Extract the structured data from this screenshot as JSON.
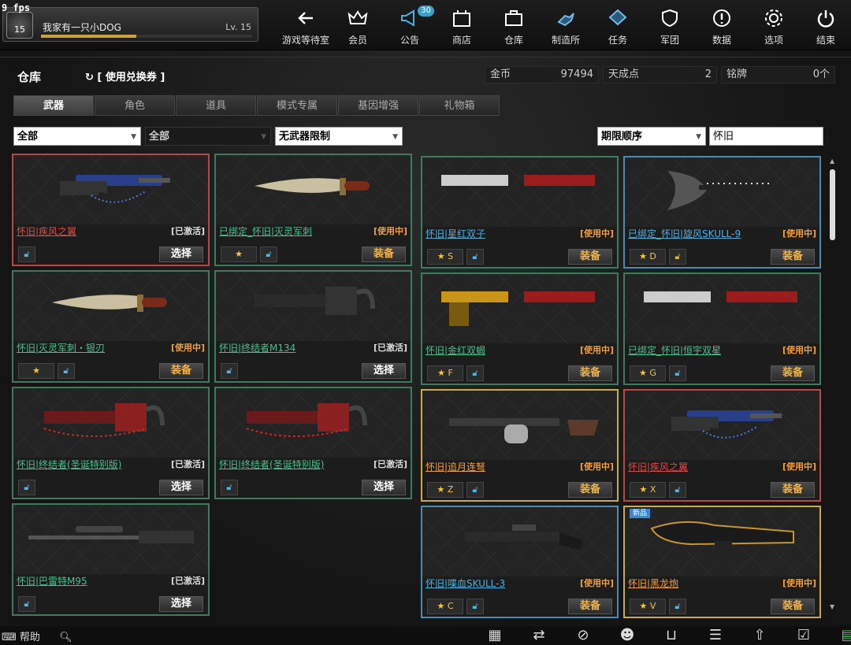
{
  "fps": "9 fps",
  "player": {
    "rank": "15",
    "name": "我家有一只小DOG",
    "level": "Lv. 15"
  },
  "nav": [
    {
      "label": "游戏等待室",
      "icon": "arrow-left-icon"
    },
    {
      "label": "会员",
      "icon": "crown-icon"
    },
    {
      "label": "公告",
      "icon": "megaphone-icon",
      "badge": "30"
    },
    {
      "label": "商店",
      "icon": "shop-icon"
    },
    {
      "label": "仓库",
      "icon": "briefcase-icon"
    },
    {
      "label": "制造所",
      "icon": "craft-icon"
    },
    {
      "label": "任务",
      "icon": "ticket-icon"
    },
    {
      "label": "军团",
      "icon": "shield-icon"
    },
    {
      "label": "数据",
      "icon": "info-icon"
    },
    {
      "label": "选项",
      "icon": "gear-icon"
    },
    {
      "label": "结束",
      "icon": "power-icon"
    }
  ],
  "header": {
    "title": "仓库",
    "coupon": "[ 使用兑换券 ]"
  },
  "currency": [
    {
      "label": "金币",
      "value": "97494"
    },
    {
      "label": "天成点",
      "value": "2"
    },
    {
      "label": "铭牌",
      "value": "0个"
    }
  ],
  "tabs": [
    "武器",
    "角色",
    "道具",
    "模式专属",
    "基因增强",
    "礼物箱"
  ],
  "filters": {
    "f1": "全部",
    "f2": "全部",
    "f3": "无武器限制",
    "sort": "期限顺序",
    "search": "怀旧"
  },
  "left_items": [
    {
      "name": "怀旧|疾风之翼",
      "status": "[已激活]",
      "button": "选择",
      "star": "",
      "color": "#e04848",
      "border": "#b84848",
      "w": "rifle-blue"
    },
    {
      "name": "已绑定_怀旧|灭灵军刺",
      "status": "[使用中]",
      "button": "装备",
      "star": "★",
      "color": "#47c08e",
      "border": "#3f7a5d",
      "w": "knife"
    },
    {
      "name": "怀旧|灭灵军刺・银刃",
      "status": "[使用中]",
      "button": "装备",
      "star": "★",
      "color": "#47c08e",
      "border": "#3f7a5d",
      "w": "knife"
    },
    {
      "name": "怀旧|终结者M134",
      "status": "[已激活]",
      "button": "选择",
      "star": "",
      "color": "#47c08e",
      "border": "#3f7a5d",
      "w": "minigun"
    },
    {
      "name": "怀旧|终结者(圣诞特别版)",
      "status": "[已激活]",
      "button": "选择",
      "star": "",
      "color": "#47c08e",
      "border": "#3f7a5d",
      "w": "minigun-red"
    },
    {
      "name": "怀旧|终结者(圣诞特别版)",
      "status": "[已激活]",
      "button": "选择",
      "star": "",
      "color": "#47c08e",
      "border": "#3f7a5d",
      "w": "minigun-red"
    },
    {
      "name": "怀旧|巴雷特M95",
      "status": "[已激活]",
      "button": "选择",
      "star": "",
      "color": "#47c08e",
      "border": "#3f7a5d",
      "w": "sniper"
    }
  ],
  "right_items": [
    {
      "name": "怀旧|星红双子",
      "status": "[使用中]",
      "button": "装备",
      "star": "★ S",
      "color": "#4ab0e0",
      "border": "#3f7a5d",
      "w": "pistols"
    },
    {
      "name": "已绑定_怀旧|旋风SKULL-9",
      "status": "[使用中]",
      "button": "装备",
      "star": "★ D",
      "color": "#4ab0e0",
      "border": "#4a8ab0",
      "w": "axe"
    },
    {
      "name": "怀旧|金红双蝎",
      "status": "[使用中]",
      "button": "装备",
      "star": "★ F",
      "color": "#47c08e",
      "border": "#3f7a5d",
      "w": "pistols-gold"
    },
    {
      "name": "已绑定_怀旧|恒宇双星",
      "status": "[使用中]",
      "button": "装备",
      "star": "★ G",
      "color": "#47c08e",
      "border": "#3f7a5d",
      "w": "pistols"
    },
    {
      "name": "怀旧|追月连弩",
      "status": "[使用中]",
      "button": "装备",
      "star": "★ Z",
      "color": "#f0a040",
      "border": "#c9a94a",
      "w": "crossbow"
    },
    {
      "name": "怀旧|疾风之翼",
      "status": "[使用中]",
      "button": "装备",
      "star": "★ X",
      "color": "#e04848",
      "border": "#b84848",
      "w": "rifle-blue"
    },
    {
      "name": "怀旧|喋血SKULL-3",
      "status": "[使用中]",
      "button": "装备",
      "star": "★ C",
      "color": "#4ab0e0",
      "border": "#4a8ab0",
      "w": "smg"
    },
    {
      "name": "怀旧|黑龙炮",
      "status": "[使用中]",
      "button": "装备",
      "star": "★ V",
      "color": "#f0a040",
      "border": "#c9a94a",
      "w": "cannon",
      "new": "新品"
    }
  ],
  "bottom": {
    "help": "帮助"
  }
}
